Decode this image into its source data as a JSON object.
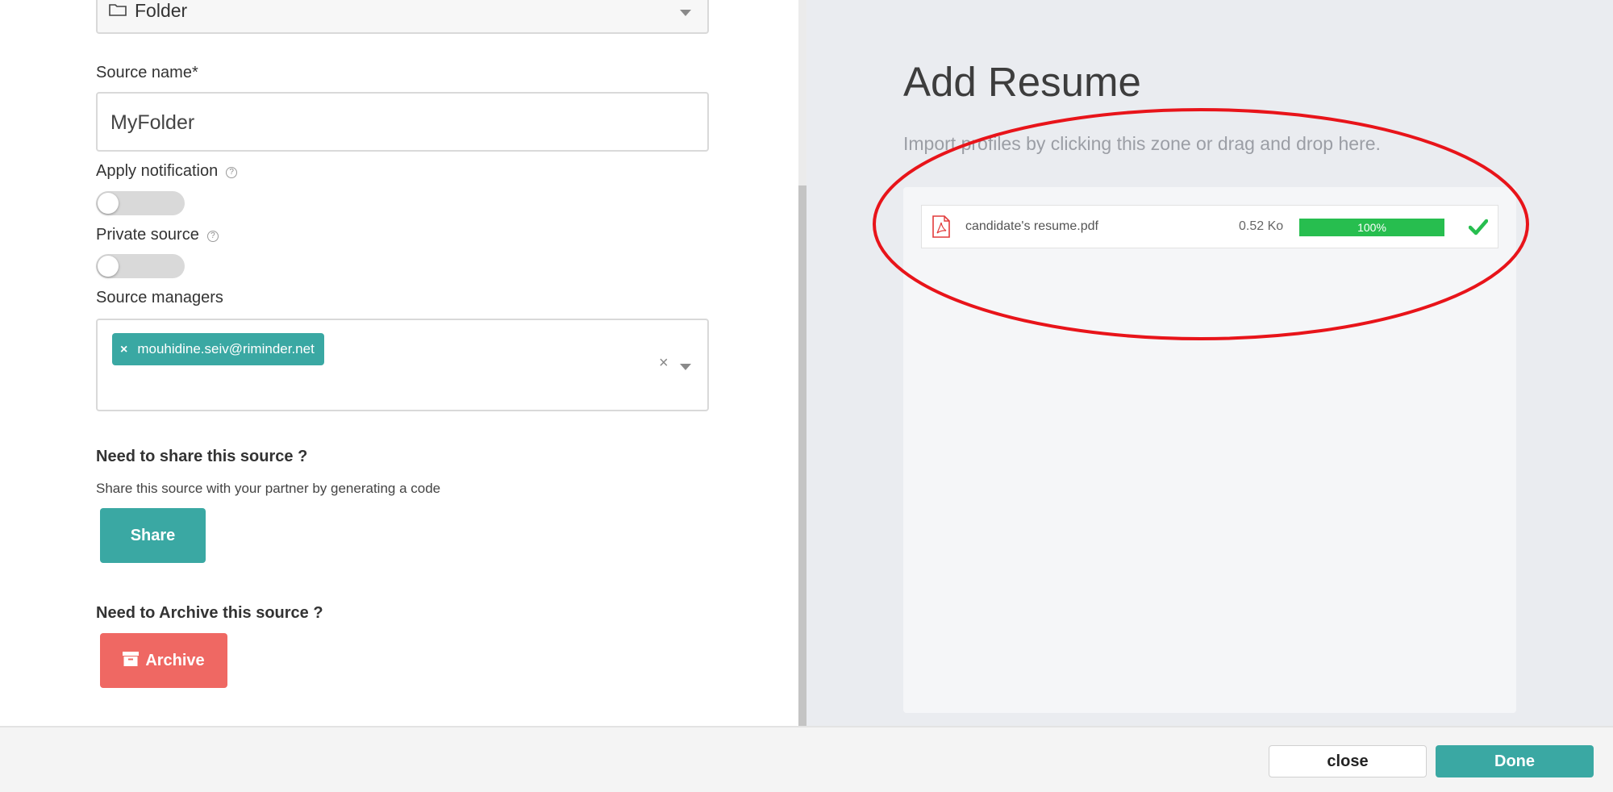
{
  "source_form": {
    "type_select": {
      "value": "Folder",
      "icon": "folder-icon"
    },
    "source_name": {
      "label": "Source name*",
      "value": "MyFolder"
    },
    "apply_notification": {
      "label": "Apply notification",
      "help": "?",
      "enabled": false
    },
    "private_source": {
      "label": "Private source",
      "help": "?",
      "enabled": false
    },
    "source_managers": {
      "label": "Source managers",
      "tags": [
        {
          "remove": "×",
          "email": "mouhidine.seiv@riminder.net"
        }
      ],
      "clear": "×"
    },
    "share_section": {
      "title": "Need to share this source ?",
      "description": "Share this source with your partner by generating a code",
      "button": "Share"
    },
    "archive_section": {
      "title": "Need to Archive this source ?",
      "button": "Archive",
      "icon": "archive-icon"
    }
  },
  "upload_panel": {
    "title": "Add Resume",
    "subtitle": "Import profiles by clicking this zone or drag and drop here.",
    "files": [
      {
        "name": "candidate's resume.pdf",
        "size": "0.52 Ko",
        "progress": 100,
        "progress_label": "100%",
        "status_icon": "check-icon",
        "file_icon": "pdf-icon"
      }
    ],
    "annotation_color": "#e8141a"
  },
  "footer": {
    "close_label": "close",
    "done_label": "Done"
  },
  "colors": {
    "accent": "#3aa8a3",
    "danger": "#ef6863",
    "success": "#27be4f"
  }
}
